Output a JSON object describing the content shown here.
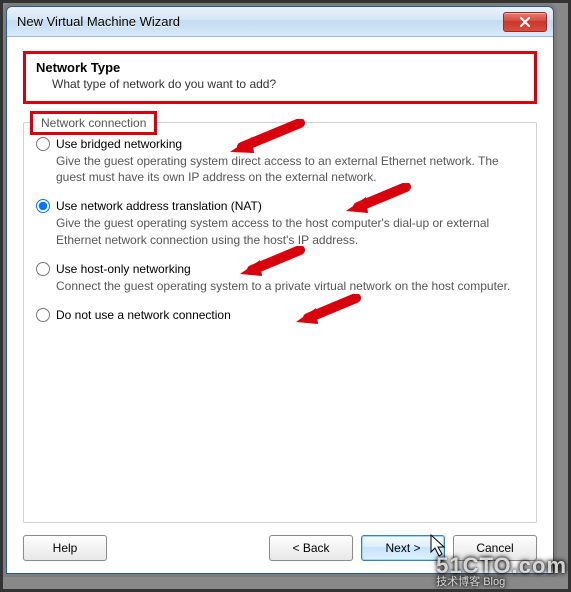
{
  "window": {
    "title": "New Virtual Machine Wizard"
  },
  "header": {
    "title": "Network Type",
    "subtitle": "What type of network do you want to add?"
  },
  "group": {
    "legend": "Network connection"
  },
  "options": [
    {
      "id": "bridged",
      "label": "Use bridged networking",
      "desc": "Give the guest operating system direct access to an external Ethernet network. The guest must have its own IP address on the external network.",
      "selected": false
    },
    {
      "id": "nat",
      "label": "Use network address translation (NAT)",
      "desc": "Give the guest operating system access to the host computer's dial-up or external Ethernet network connection using the host's IP address.",
      "selected": true
    },
    {
      "id": "hostonly",
      "label": "Use host-only networking",
      "desc": "Connect the guest operating system to a private virtual network on the host computer.",
      "selected": false
    },
    {
      "id": "none",
      "label": "Do not use a network connection",
      "desc": "",
      "selected": false
    }
  ],
  "buttons": {
    "help": "Help",
    "back": "< Back",
    "next": "Next >",
    "cancel": "Cancel"
  },
  "watermark": {
    "main": "51CTO.com",
    "sub": "技术博客  Blog"
  },
  "colors": {
    "annotation": "#d8000c"
  }
}
